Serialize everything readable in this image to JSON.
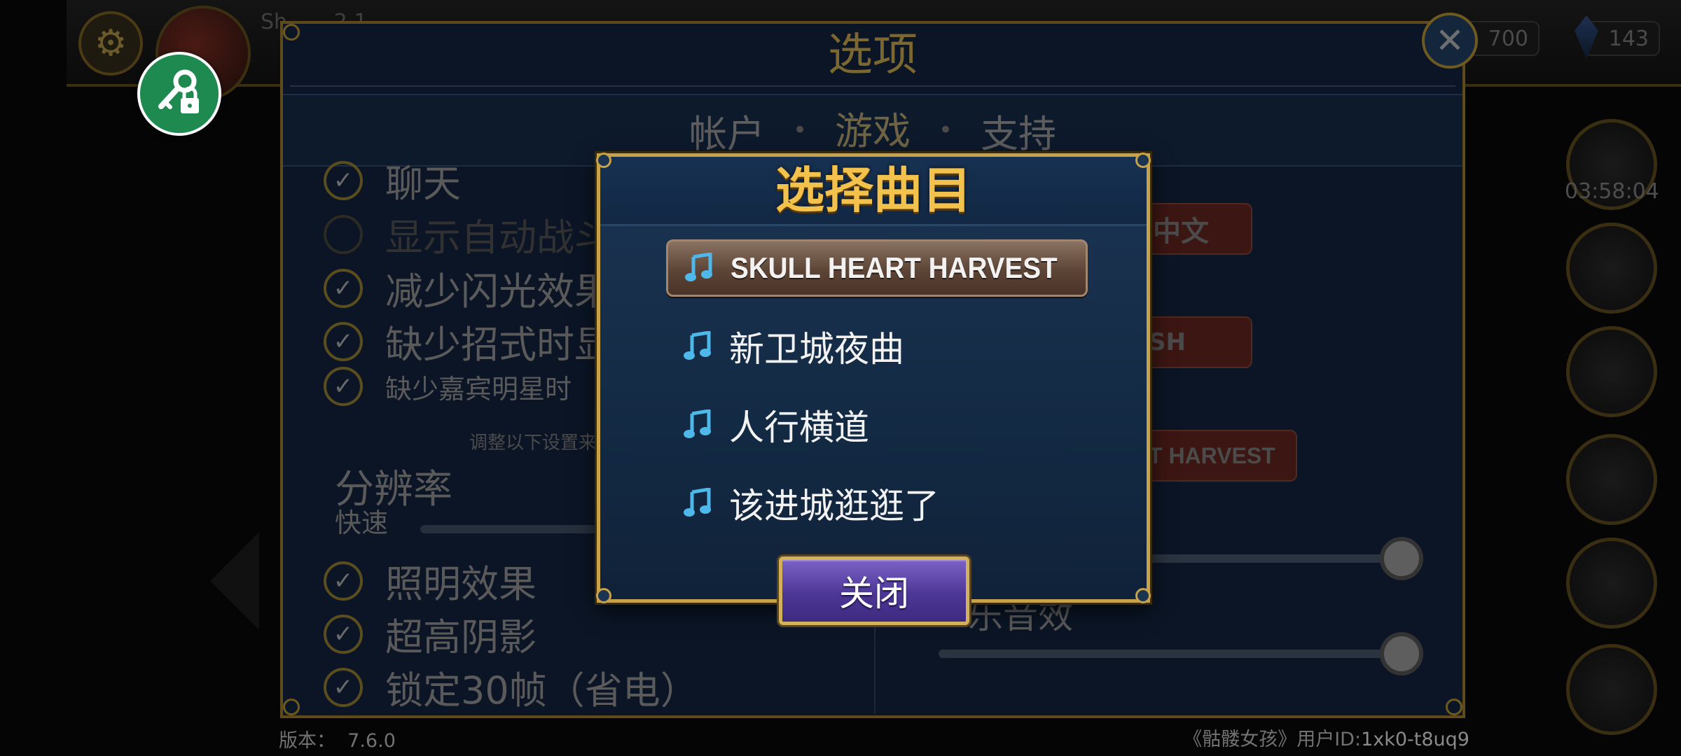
{
  "background": {
    "top_name": "Sh... ...2.1...",
    "resource_value": "700",
    "gem_value": "143",
    "timer": "03:58:04",
    "options": {
      "title": "选项",
      "tabs": [
        "帐户",
        "游戏",
        "支持"
      ],
      "active_tab": "游戏",
      "checks": [
        {
          "label": "聊天",
          "checked": true
        },
        {
          "label": "显示自动战斗",
          "checked": false
        },
        {
          "label": "减少闪光效果",
          "checked": true
        },
        {
          "label": "缺少招式时显示",
          "checked": true
        },
        {
          "label": "缺少嘉宾明星时",
          "checked": true
        }
      ],
      "adjust_note": "调整以下设置来",
      "resolution_label": "分辨率",
      "resolution_speed": "快速",
      "checks_bottom": [
        {
          "label": "照明效果",
          "checked": true
        },
        {
          "label": "超高阴影",
          "checked": true
        },
        {
          "label": "锁定30帧（省电）",
          "checked": true
        }
      ],
      "language_button": "中文",
      "language_button_2": "SH",
      "music_button": "T HARVEST",
      "sfx_label": "乐音效",
      "music_volume": 1.0,
      "sfx_volume": 1.0,
      "version_label": "版本：",
      "version_value": "7.6.0",
      "user_id_label": "《骷髅女孩》用户ID:",
      "user_id_value": "1xk0-t8uq9"
    }
  },
  "modal": {
    "title": "选择曲目",
    "tracks": [
      {
        "name": "SKULL HEART HARVEST",
        "selected": true
      },
      {
        "name": "新卫城夜曲",
        "selected": false
      },
      {
        "name": "人行横道",
        "selected": false
      },
      {
        "name": "该进城逛逛了",
        "selected": false
      }
    ],
    "close_label": "关闭"
  },
  "icons": {
    "settings": "gear-icon",
    "account_lock": "key-lock-icon",
    "track": "music-note-icon",
    "options_close": "close-icon"
  },
  "colors": {
    "modal_title": "#f3c24c",
    "modal_border": "#c6a24a",
    "close_button": "#4d3796",
    "lock_button": "#1e8a50",
    "note_icon": "#4fb8ea"
  }
}
